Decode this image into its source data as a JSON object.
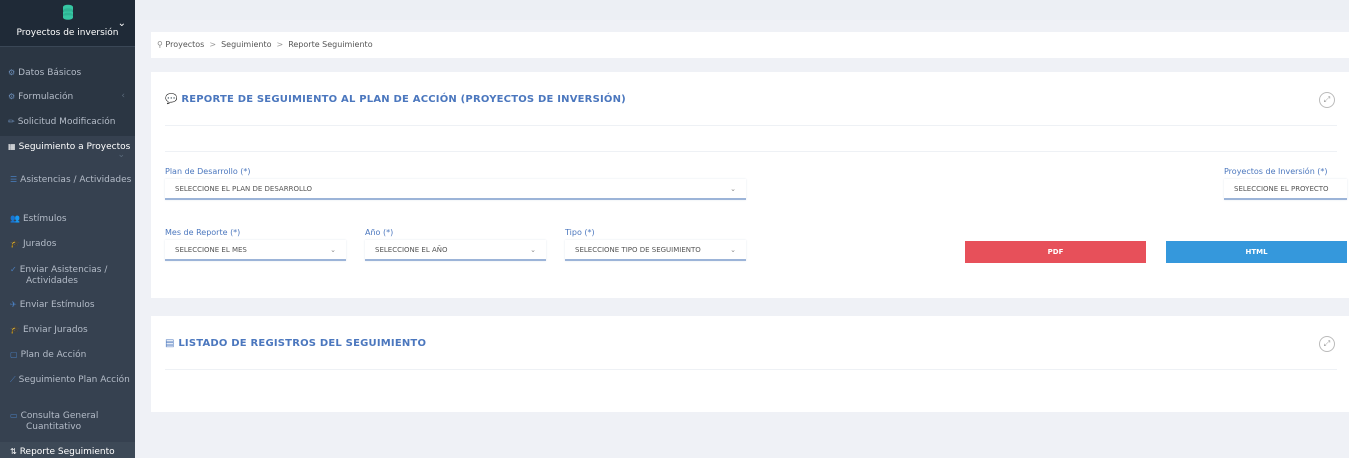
{
  "sidebar": {
    "title": "Proyectos de inversión",
    "items": [
      {
        "icon": "⚙",
        "label": "Datos Básicos"
      },
      {
        "icon": "⚙",
        "label": "Formulación"
      },
      {
        "icon": "✏",
        "label": "Solicitud Modificación"
      },
      {
        "icon": "▦",
        "label": "Seguimiento a Proyectos"
      },
      {
        "icon": "☰",
        "label": "Asistencias / Actividades"
      },
      {
        "icon": "👥",
        "label": "Estímulos"
      },
      {
        "icon": "🎓",
        "label": "Jurados"
      },
      {
        "icon": "✓",
        "label": "Enviar Asistencias / Actividades"
      },
      {
        "icon": "✈",
        "label": "Enviar Estímulos"
      },
      {
        "icon": "🎓",
        "label": "Enviar Jurados"
      },
      {
        "icon": "▢",
        "label": "Plan de Acción"
      },
      {
        "icon": "⟋",
        "label": "Seguimiento Plan Acción"
      },
      {
        "icon": "▭",
        "label": "Consulta General Cuantitativo"
      },
      {
        "icon": "⇅",
        "label": "Reporte Seguimiento"
      }
    ]
  },
  "breadcrumb": {
    "items": [
      "Proyectos",
      "Seguimiento",
      "Reporte Seguimiento"
    ],
    "separator": ">"
  },
  "report_panel": {
    "title": "REPORTE DE SEGUIMIENTO AL PLAN DE ACCIÓN (PROYECTOS DE INVERSIÓN)",
    "fields": {
      "plan": {
        "label": "Plan de Desarrollo (*)",
        "value": "SELECCIONE EL PLAN DE DESARROLLO"
      },
      "proyectos": {
        "label": "Proyectos de Inversión (*)",
        "value": "SELECCIONE EL PROYECTO"
      },
      "mes": {
        "label": "Mes de Reporte (*)",
        "value": "SELECCIONE EL MES"
      },
      "anio": {
        "label": "Año (*)",
        "value": "SELECCIONE EL AÑO"
      },
      "tipo": {
        "label": "Tipo (*)",
        "value": "SELECCIONE TIPO DE SEGUIMIENTO"
      }
    },
    "buttons": {
      "pdf": "PDF",
      "html": "HTML"
    }
  },
  "list_panel": {
    "title": "LISTADO DE REGISTROS DEL SEGUIMIENTO"
  },
  "colors": {
    "sidebar_bg": "#2b3643",
    "accent": "#4b77be",
    "pdf_button": "#e7505a",
    "html_button": "#3598dc"
  },
  "icons": {
    "chevron": "⌄",
    "caret": "⌄",
    "expand": "⤢"
  }
}
